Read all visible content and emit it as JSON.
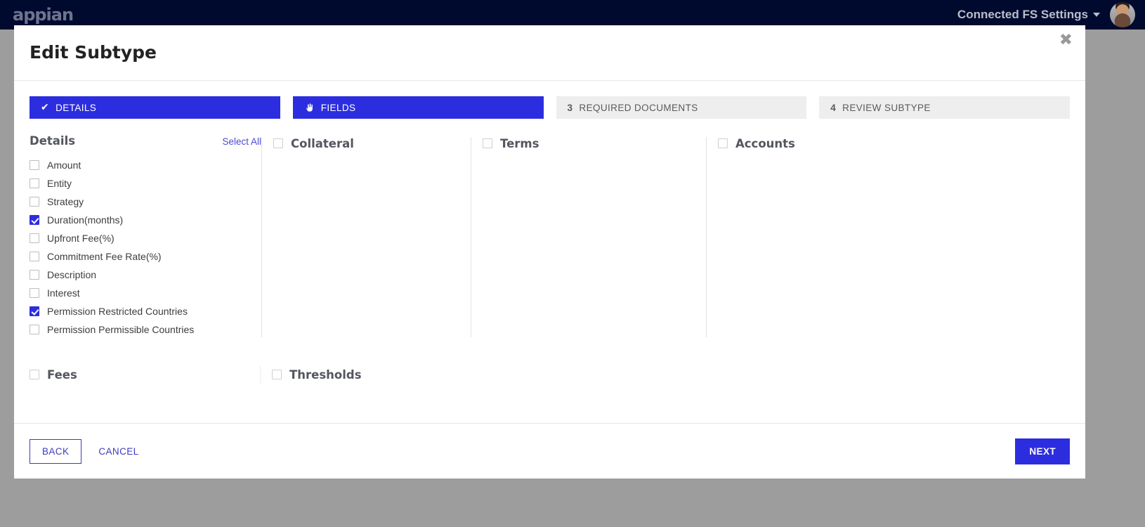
{
  "topbar": {
    "logo_text": "appian",
    "settings_label": "Connected FS Settings",
    "caret_icon": "chevron-down-icon",
    "avatar_icon": "user-avatar"
  },
  "modal": {
    "title": "Edit Subtype",
    "close_label": "✖"
  },
  "steps": [
    {
      "num": "",
      "label": "DETAILS",
      "state": "done",
      "icon": "check-icon",
      "glyph": "✔"
    },
    {
      "num": "",
      "label": "FIELDS",
      "state": "active",
      "icon": "pointing-hand-icon",
      "glyph": ""
    },
    {
      "num": "3",
      "label": "REQUIRED DOCUMENTS",
      "state": "todo",
      "icon": "",
      "glyph": ""
    },
    {
      "num": "4",
      "label": "REVIEW SUBTYPE",
      "state": "todo",
      "icon": "",
      "glyph": ""
    }
  ],
  "details": {
    "title": "Details",
    "select_all_label": "Select All",
    "options": [
      {
        "label": "Amount",
        "checked": false
      },
      {
        "label": "Entity",
        "checked": false
      },
      {
        "label": "Strategy",
        "checked": false
      },
      {
        "label": "Duration(months)",
        "checked": true
      },
      {
        "label": "Upfront Fee(%)",
        "checked": false
      },
      {
        "label": "Commitment Fee Rate(%)",
        "checked": false
      },
      {
        "label": "Description",
        "checked": false
      },
      {
        "label": "Interest",
        "checked": false
      },
      {
        "label": "Permission Restricted Countries",
        "checked": true
      },
      {
        "label": "Permission Permissible Countries",
        "checked": false
      }
    ]
  },
  "groups": [
    {
      "title": "Collateral",
      "checked": false
    },
    {
      "title": "Terms",
      "checked": false
    },
    {
      "title": "Accounts",
      "checked": false
    }
  ],
  "groups_row2": [
    {
      "title": "Fees",
      "checked": false
    },
    {
      "title": "Thresholds",
      "checked": false
    }
  ],
  "footer": {
    "back_label": "BACK",
    "cancel_label": "CANCEL",
    "next_label": "NEXT"
  },
  "colors": {
    "accent_blue": "#2d2de0",
    "navbar_navy": "#000a2e",
    "link_blue": "#4b4bcf",
    "step_inactive": "#eeeeee",
    "page_backdrop": "#9d9d9d"
  }
}
